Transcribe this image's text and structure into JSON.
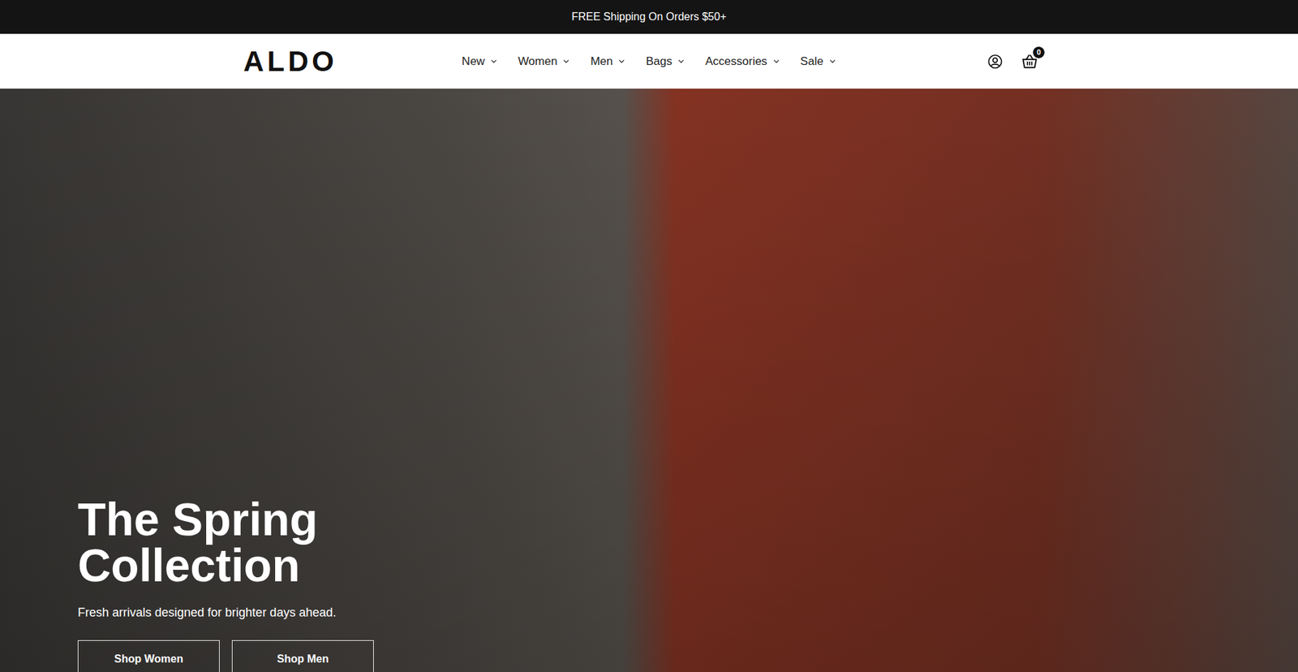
{
  "announcement": {
    "text": "FREE Shipping On Orders $50+"
  },
  "header": {
    "logo": "ALDO",
    "nav": [
      {
        "label": "New"
      },
      {
        "label": "Women"
      },
      {
        "label": "Men"
      },
      {
        "label": "Bags"
      },
      {
        "label": "Accessories"
      },
      {
        "label": "Sale"
      }
    ],
    "cart_count": "0"
  },
  "hero": {
    "title": "The Spring Collection",
    "subtitle": "Fresh arrivals designed for brighter days ahead.",
    "buttons": [
      "Shop Women",
      "Shop Men"
    ]
  }
}
